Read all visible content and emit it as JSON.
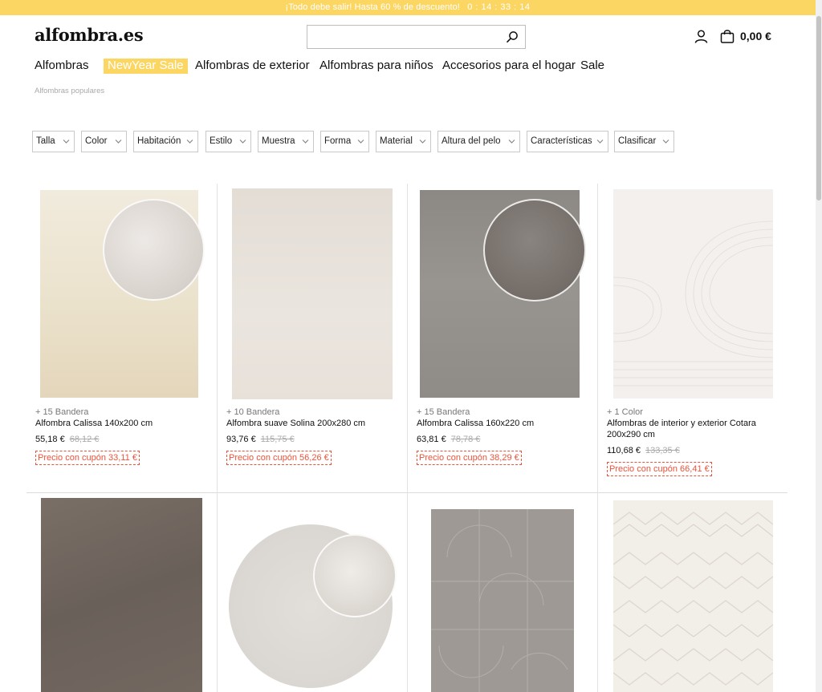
{
  "promo": {
    "text": "¡Todo debe salir! Hasta 60 % de descuento!",
    "timer": "0 : 14 : 33 : 14"
  },
  "header": {
    "logo": "alfombra.es",
    "search": {
      "value": "",
      "placeholder": ""
    },
    "cart_total": "0,00 €"
  },
  "nav": {
    "items": [
      {
        "label": "Alfombras"
      },
      {
        "label": "NewYear Sale",
        "highlight": true
      },
      {
        "label": "Alfombras de exterior"
      },
      {
        "label": "Alfombras para niños"
      },
      {
        "label": "Accesorios para el hogar"
      },
      {
        "label": "Sale"
      }
    ]
  },
  "breadcrumb": "Alfombras populares",
  "filters": [
    "Talla",
    "Color",
    "Habitación",
    "Estilo",
    "Muestra",
    "Forma",
    "Material",
    "Altura del pelo",
    "Características",
    "Clasificar"
  ],
  "products": [
    {
      "variants": "+ 15 Bandera",
      "title": "Alfombra Calissa 140x200 cm",
      "price": "55,18 €",
      "old_price": "68,12 €",
      "coupon": "Precio con cupón 33,11 €",
      "color": "#ece3d0"
    },
    {
      "variants": "+ 10 Bandera",
      "title": "Alfombra suave Solina 200x280 cm",
      "price": "93,76 €",
      "old_price": "115,75 €",
      "coupon": "Precio con cupón 56,26 €",
      "color": "#e6e0da"
    },
    {
      "variants": "+ 15 Bandera",
      "title": "Alfombra Calissa 160x220 cm",
      "price": "63,81 €",
      "old_price": "78,78 €",
      "coupon": "Precio con cupón 38,29 €",
      "color": "#8e8a86"
    },
    {
      "variants": "+ 1 Color",
      "title": "Alfombras de interior y exterior Cotara 200x290 cm",
      "price": "110,68 €",
      "old_price": "133,35 €",
      "coupon": "Precio con cupón 66,41 €",
      "color": "#f2efec"
    },
    {
      "color": "#6f655e"
    },
    {
      "color": "#dbd8d4"
    },
    {
      "color": "#9d9893"
    },
    {
      "color": "#f1ede7"
    }
  ],
  "colors": {
    "accent": "#fcd663",
    "coupon": "#e8543b"
  }
}
